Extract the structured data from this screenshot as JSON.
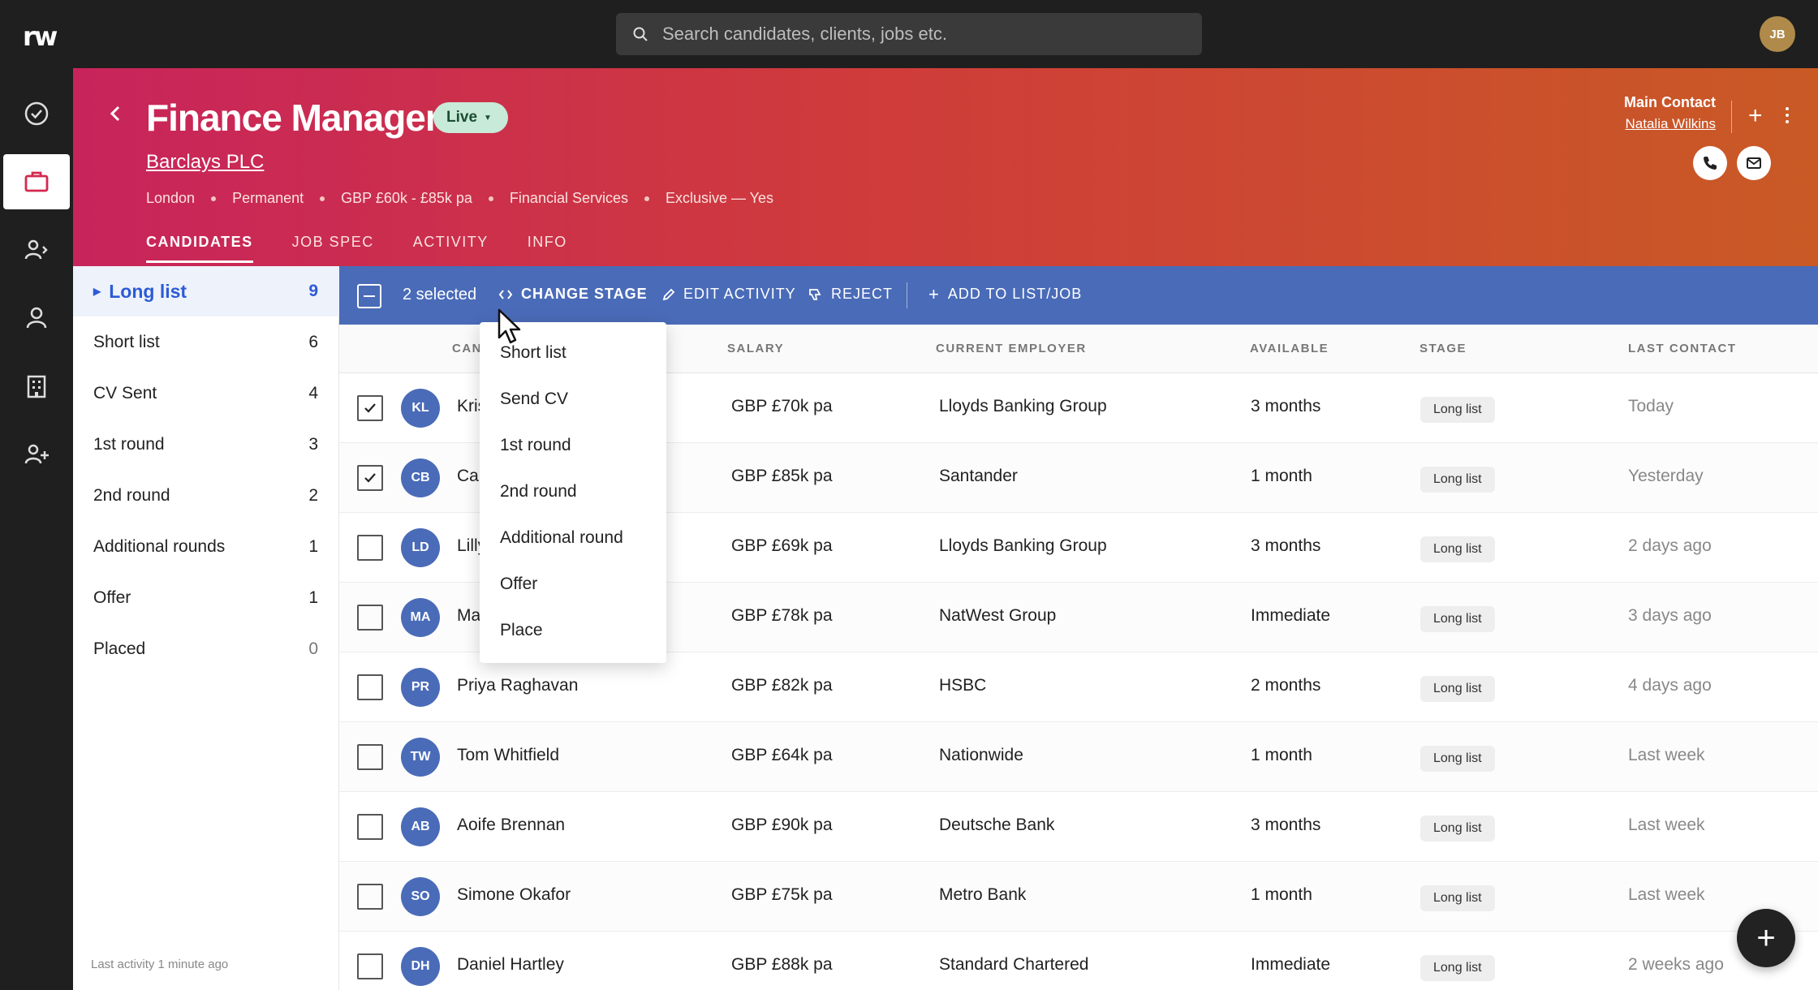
{
  "app": {
    "logo": "rw",
    "user_initials": "JB"
  },
  "search": {
    "placeholder": "Search candidates, clients, jobs etc."
  },
  "job": {
    "title": "Finance Manager",
    "status": "Live",
    "company": "Barclays PLC",
    "meta": [
      "London",
      "Permanent",
      "GBP £60k - £85k pa",
      "Financial Services",
      "Exclusive — Yes"
    ],
    "main_contact_label": "Main Contact",
    "main_contact_name": "Natalia Wilkins"
  },
  "tabs": [
    {
      "label": "CANDIDATES",
      "active": true
    },
    {
      "label": "JOB SPEC",
      "active": false
    },
    {
      "label": "ACTIVITY",
      "active": false
    },
    {
      "label": "INFO",
      "active": false
    }
  ],
  "stages": [
    {
      "label": "Long list",
      "count": "9",
      "active": true
    },
    {
      "label": "Short list",
      "count": "6"
    },
    {
      "label": "CV Sent",
      "count": "4"
    },
    {
      "label": "1st round",
      "count": "3"
    },
    {
      "label": "2nd round",
      "count": "2"
    },
    {
      "label": "Additional rounds",
      "count": "1"
    },
    {
      "label": "Offer",
      "count": "1"
    },
    {
      "label": "Placed",
      "count": "0"
    }
  ],
  "last_activity": "Last activity 1 minute ago",
  "actionbar": {
    "selected": "2 selected",
    "change_stage": "CHANGE STAGE",
    "edit_activity": "EDIT ACTIVITY",
    "reject": "REJECT",
    "add_to_list": "ADD TO LIST/JOB"
  },
  "columns": {
    "candidate": "CAN",
    "salary": "SALARY",
    "employer": "CURRENT EMPLOYER",
    "available": "AVAILABLE",
    "stage": "STAGE",
    "last_contact": "LAST CONTACT"
  },
  "rows": [
    {
      "initials": "KL",
      "name": "Kris",
      "salary": "GBP £70k pa",
      "employer": "Lloyds Banking Group",
      "available": "3 months",
      "stage": "Long list",
      "last_contact": "Today",
      "checked": true
    },
    {
      "initials": "CB",
      "name": "Ca",
      "salary": "GBP £85k pa",
      "employer": "Santander",
      "available": "1 month",
      "stage": "Long list",
      "last_contact": "Yesterday",
      "checked": true
    },
    {
      "initials": "LD",
      "name": "Lilly",
      "salary": "GBP £69k pa",
      "employer": "Lloyds Banking Group",
      "available": "3 months",
      "stage": "Long list",
      "last_contact": "2 days ago",
      "checked": false
    },
    {
      "initials": "MA",
      "name": "Ma",
      "salary": "GBP £78k pa",
      "employer": "NatWest Group",
      "available": "Immediate",
      "stage": "Long list",
      "last_contact": "3 days ago",
      "checked": false
    },
    {
      "initials": "PR",
      "name": "Priya Raghavan",
      "salary": "GBP £82k pa",
      "employer": "HSBC",
      "available": "2 months",
      "stage": "Long list",
      "last_contact": "4 days ago",
      "checked": false
    },
    {
      "initials": "TW",
      "name": "Tom Whitfield",
      "salary": "GBP £64k pa",
      "employer": "Nationwide",
      "available": "1 month",
      "stage": "Long list",
      "last_contact": "Last week",
      "checked": false
    },
    {
      "initials": "AB",
      "name": "Aoife Brennan",
      "salary": "GBP £90k pa",
      "employer": "Deutsche Bank",
      "available": "3 months",
      "stage": "Long list",
      "last_contact": "Last week",
      "checked": false
    },
    {
      "initials": "SO",
      "name": "Simone Okafor",
      "salary": "GBP £75k pa",
      "employer": "Metro Bank",
      "available": "1 month",
      "stage": "Long list",
      "last_contact": "Last week",
      "checked": false
    },
    {
      "initials": "DH",
      "name": "Daniel Hartley",
      "salary": "GBP £88k pa",
      "employer": "Standard Chartered",
      "available": "Immediate",
      "stage": "Long list",
      "last_contact": "2 weeks ago",
      "checked": false
    }
  ],
  "dropdown": [
    "Short list",
    "Send CV",
    "1st round",
    "2nd round",
    "Additional round",
    "Offer",
    "Place"
  ],
  "colors": {
    "accent": "#2d5bd7",
    "actionbar": "#4a6bb8",
    "header_start": "#c8245c",
    "header_end": "#c95a25"
  }
}
